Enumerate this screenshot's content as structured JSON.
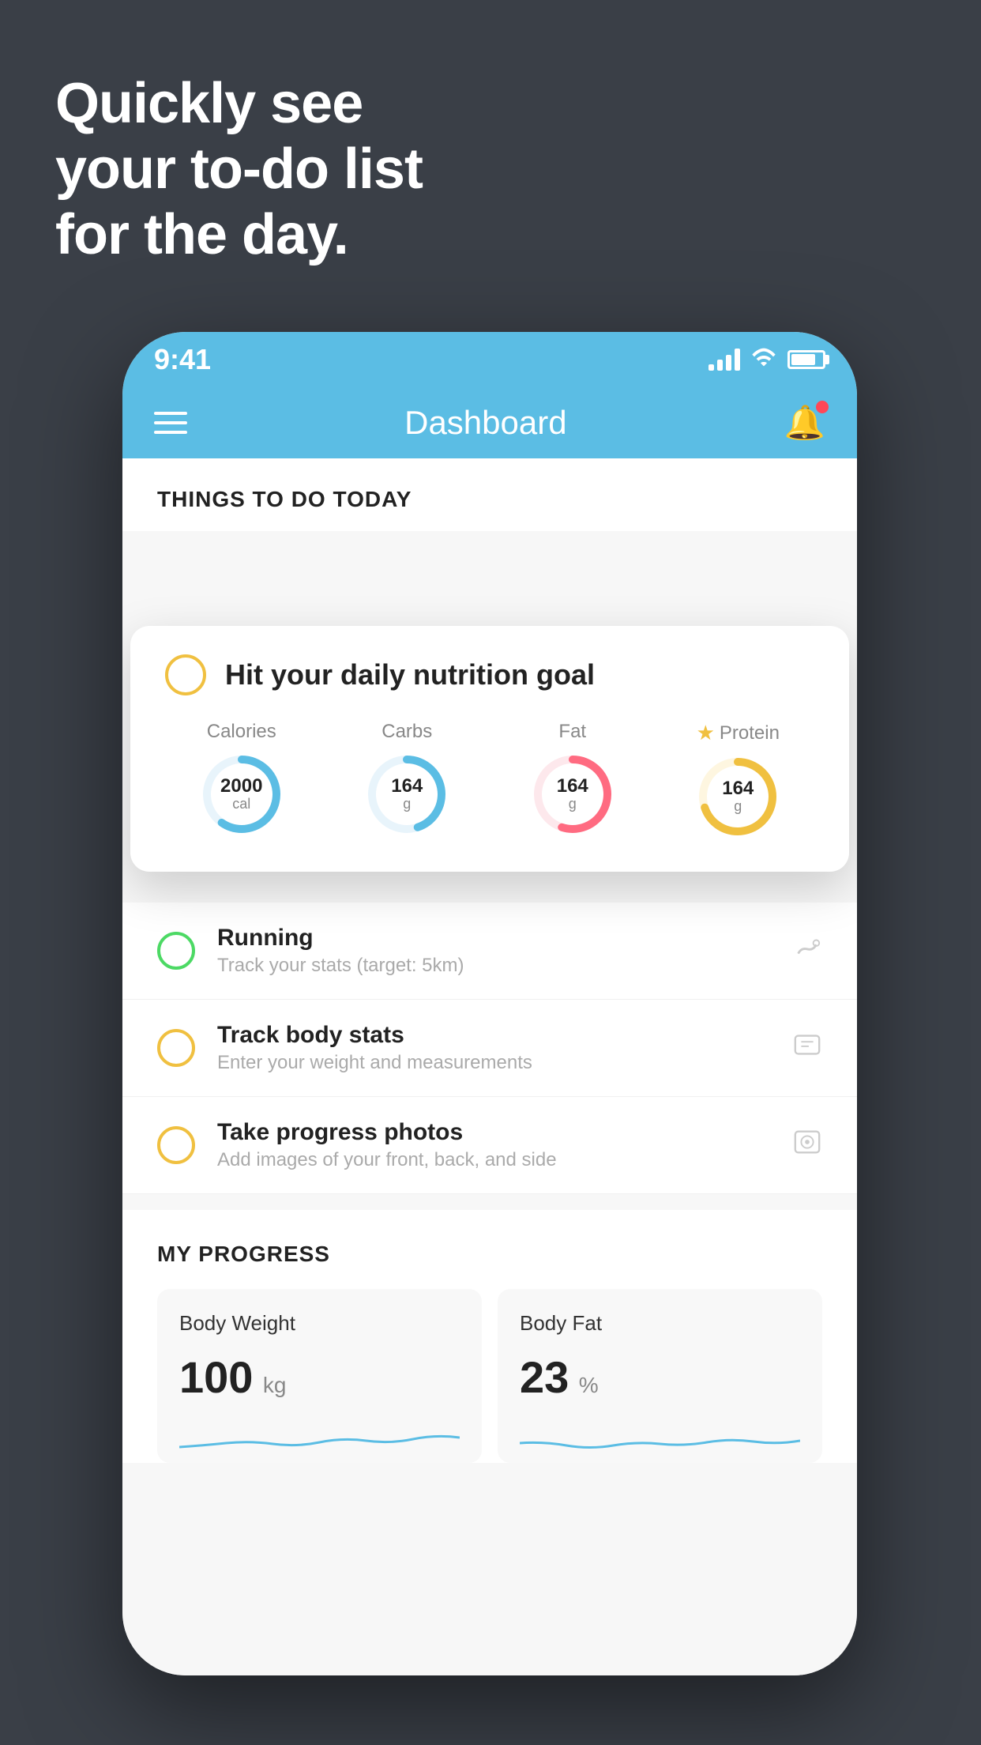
{
  "background": {
    "color": "#3a3f47"
  },
  "headline": {
    "line1": "Quickly see",
    "line2": "your to-do list",
    "line3": "for the day."
  },
  "status_bar": {
    "time": "9:41",
    "signal": "full",
    "wifi": "on",
    "battery": "80"
  },
  "header": {
    "title": "Dashboard"
  },
  "things_section": {
    "title": "THINGS TO DO TODAY"
  },
  "floating_card": {
    "checkbox_color": "#f0c040",
    "title": "Hit your daily nutrition goal",
    "nutrients": [
      {
        "label": "Calories",
        "value": "2000",
        "unit": "cal",
        "color": "#5bbde4",
        "percent": 60
      },
      {
        "label": "Carbs",
        "value": "164",
        "unit": "g",
        "color": "#5bbde4",
        "percent": 45
      },
      {
        "label": "Fat",
        "value": "164",
        "unit": "g",
        "color": "#ff6b81",
        "percent": 55
      },
      {
        "label": "Protein",
        "value": "164",
        "unit": "g",
        "color": "#f0c040",
        "percent": 70,
        "starred": true
      }
    ]
  },
  "todo_items": [
    {
      "name": "Running",
      "desc": "Track your stats (target: 5km)",
      "circle_color": "green",
      "icon": "👟"
    },
    {
      "name": "Track body stats",
      "desc": "Enter your weight and measurements",
      "circle_color": "yellow",
      "icon": "⚖️"
    },
    {
      "name": "Take progress photos",
      "desc": "Add images of your front, back, and side",
      "circle_color": "yellow",
      "icon": "🖼️"
    }
  ],
  "progress_section": {
    "title": "MY PROGRESS",
    "cards": [
      {
        "title": "Body Weight",
        "value": "100",
        "unit": "kg"
      },
      {
        "title": "Body Fat",
        "value": "23",
        "unit": "%"
      }
    ]
  }
}
